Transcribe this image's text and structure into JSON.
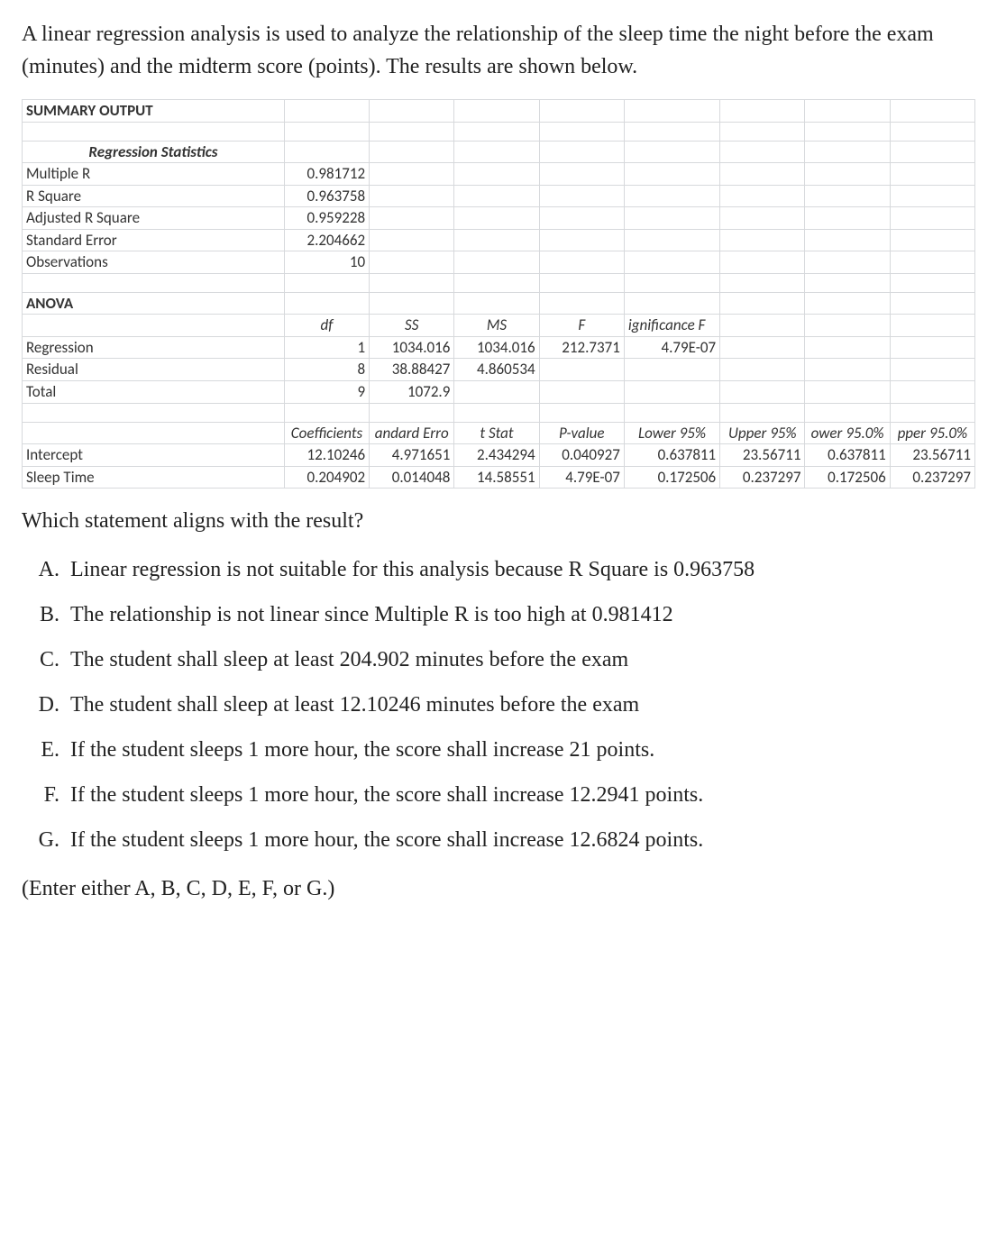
{
  "intro": "A linear regression analysis is used to analyze the relationship of the sleep time the night before the exam (minutes) and the midterm score (points). The results are shown below.",
  "reg": {
    "summary_label": "SUMMARY OUTPUT",
    "regstats_label": "Regression Statistics",
    "stats": {
      "multiple_r_label": "Multiple R",
      "multiple_r": "0.981712",
      "r_square_label": "R Square",
      "r_square": "0.963758",
      "adj_r_square_label": "Adjusted R Square",
      "adj_r_square": "0.959228",
      "std_error_label": "Standard Error",
      "std_error": "2.204662",
      "observations_label": "Observations",
      "observations": "10"
    },
    "anova_label": "ANOVA",
    "anova_headers": {
      "df": "df",
      "ss": "SS",
      "ms": "MS",
      "f": "F",
      "sigf": "ignificance F"
    },
    "anova": {
      "regression_label": "Regression",
      "regression_df": "1",
      "regression_ss": "1034.016",
      "regression_ms": "1034.016",
      "regression_f": "212.7371",
      "regression_sigf": "4.79E-07",
      "residual_label": "Residual",
      "residual_df": "8",
      "residual_ss": "38.88427",
      "residual_ms": "4.860534",
      "total_label": "Total",
      "total_df": "9",
      "total_ss": "1072.9"
    },
    "coef_headers": {
      "coef": "Coefficients",
      "se": "andard Erro",
      "tstat": "t Stat",
      "pval": "P-value",
      "l95": "Lower 95%",
      "u95": "Upper 95%",
      "l95b": "ower 95.0%",
      "u95b": "pper 95.0%"
    },
    "intercept": {
      "label": "Intercept",
      "coef": "12.10246",
      "se": "4.971651",
      "tstat": "2.434294",
      "pval": "0.040927",
      "l95": "0.637811",
      "u95": "23.56711",
      "l95b": "0.637811",
      "u95b": "23.56711"
    },
    "sleep": {
      "label": "Sleep Time",
      "coef": "0.204902",
      "se": "0.014048",
      "tstat": "14.58551",
      "pval": "4.79E-07",
      "l95": "0.172506",
      "u95": "0.237297",
      "l95b": "0.172506",
      "u95b": "0.237297"
    }
  },
  "question": "Which statement aligns with the result?",
  "options": {
    "a": "Linear regression is not suitable for this analysis because R Square is 0.963758",
    "b": "The relationship is not linear since Multiple R is too high at 0.981412",
    "c": "The student shall sleep at least 204.902 minutes before the exam",
    "d": "The student shall sleep at least 12.10246 minutes before the exam",
    "e": "If the student sleeps 1 more hour, the score shall increase 21 points.",
    "f": "If the student sleeps 1 more hour, the score shall increase 12.2941 points.",
    "g": "If the student sleeps 1 more hour, the score shall increase 12.6824 points."
  },
  "hint": "(Enter either A, B, C, D, E, F, or G.)"
}
